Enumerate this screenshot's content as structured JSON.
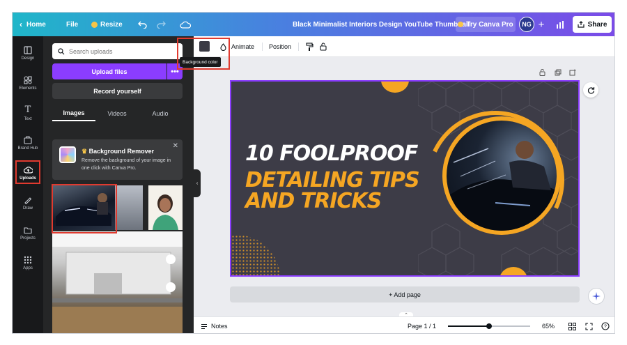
{
  "topbar": {
    "home": "Home",
    "file": "File",
    "resize": "Resize",
    "doc_title": "Black Minimalist Interiors Design YouTube Thumbnail",
    "try_pro": "Try Canva Pro",
    "avatar_initials": "NG",
    "share": "Share"
  },
  "rail": {
    "items": [
      {
        "label": "Design",
        "icon": "design-icon"
      },
      {
        "label": "Elements",
        "icon": "elements-icon"
      },
      {
        "label": "Text",
        "icon": "text-icon"
      },
      {
        "label": "Brand Hub",
        "icon": "brand-hub-icon"
      },
      {
        "label": "Uploads",
        "icon": "uploads-icon"
      },
      {
        "label": "Draw",
        "icon": "draw-icon"
      },
      {
        "label": "Projects",
        "icon": "projects-icon"
      },
      {
        "label": "Apps",
        "icon": "apps-icon"
      }
    ]
  },
  "panel": {
    "search_placeholder": "Search uploads",
    "upload_files": "Upload files",
    "more": "•••",
    "record_yourself": "Record yourself",
    "tabs": [
      "Images",
      "Videos",
      "Audio"
    ],
    "bg_remover": {
      "title": "Background Remover",
      "desc": "Remove the background of your image in one click with Canva Pro."
    }
  },
  "toolbar": {
    "tooltip": "Background color",
    "animate": "Animate",
    "position": "Position"
  },
  "design": {
    "line1": "10 FOOLPROOF",
    "line2": "DETAILING TIPS AND TRICKS",
    "colors": {
      "bg": "#3d3c47",
      "accent": "#f5a623",
      "selection": "#8b3dff"
    }
  },
  "addpage": "+ Add page",
  "bottombar": {
    "notes": "Notes",
    "page": "Page 1 / 1",
    "zoom": "65%",
    "zoom_level": 0.5
  },
  "colors": {
    "brand_purple": "#8b3dff",
    "highlight_red": "#e03a2f"
  }
}
